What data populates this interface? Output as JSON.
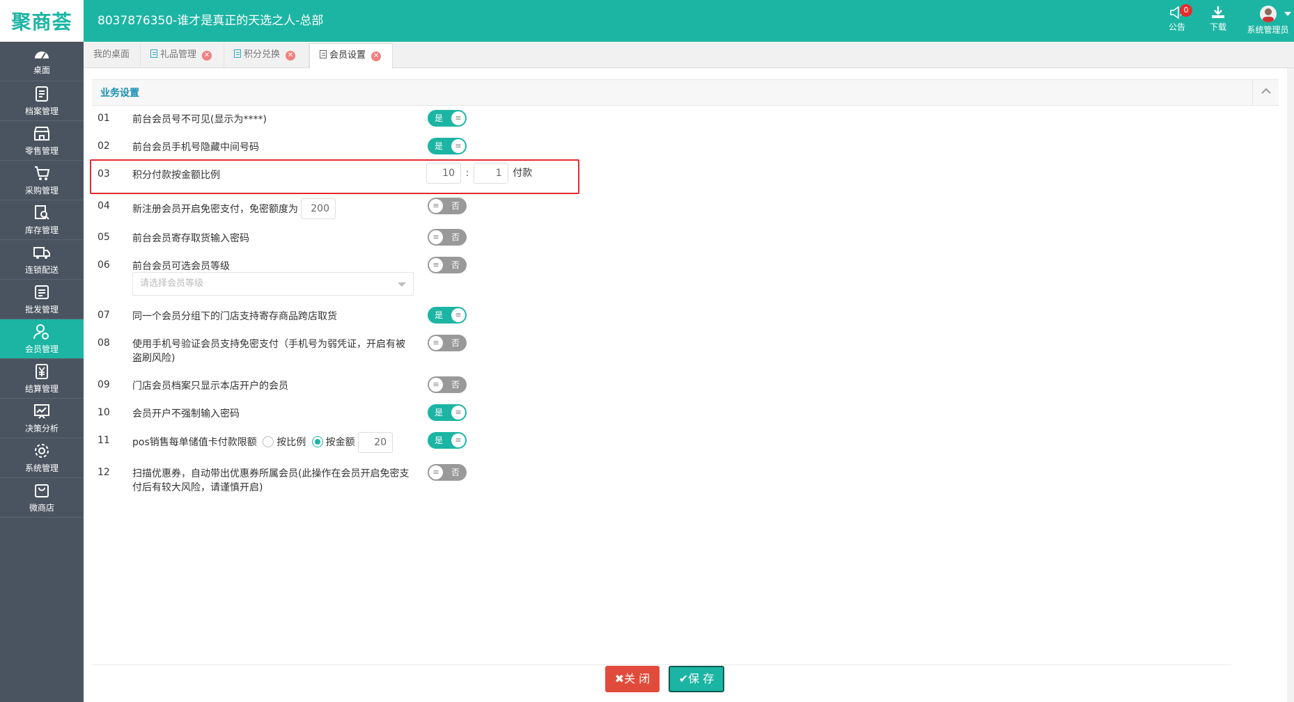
{
  "header": {
    "logo": "聚商荟",
    "title": "8037876350-谁才是真正的天选之人-总部",
    "notice_label": "公告",
    "notice_count": "0",
    "download_label": "下载",
    "user_label": "系统管理员"
  },
  "sidebar": {
    "items": [
      {
        "label": "桌面",
        "icon": "dashboard-icon"
      },
      {
        "label": "档案管理",
        "icon": "archive-icon"
      },
      {
        "label": "零售管理",
        "icon": "store-icon"
      },
      {
        "label": "采购管理",
        "icon": "cart-icon"
      },
      {
        "label": "库存管理",
        "icon": "inventory-icon"
      },
      {
        "label": "连锁配送",
        "icon": "truck-icon"
      },
      {
        "label": "批发管理",
        "icon": "wholesale-icon"
      },
      {
        "label": "会员管理",
        "icon": "member-icon",
        "active": true
      },
      {
        "label": "结算管理",
        "icon": "yen-icon"
      },
      {
        "label": "决策分析",
        "icon": "chart-icon"
      },
      {
        "label": "系统管理",
        "icon": "gear-icon"
      },
      {
        "label": "微商店",
        "icon": "shop-bag-icon"
      }
    ]
  },
  "tabs": [
    {
      "label": "我的桌面"
    },
    {
      "label": "礼品管理"
    },
    {
      "label": "积分兑换"
    },
    {
      "label": "会员设置",
      "active": true
    }
  ],
  "panel": {
    "title": "业务设置"
  },
  "settings": {
    "r01": {
      "num": "01",
      "label": "前台会员号不可见(显示为****)",
      "toggle": "是",
      "on": true
    },
    "r02": {
      "num": "02",
      "label": "前台会员手机号隐藏中间号码",
      "toggle": "是",
      "on": true
    },
    "r03": {
      "num": "03",
      "label": "积分付款按金额比例",
      "points": "10",
      "sep": ":",
      "amount": "1",
      "suffix": "付款"
    },
    "r04": {
      "num": "04",
      "label": "新注册会员开启免密支付，免密额度为",
      "limit": "200",
      "toggle": "否",
      "on": false
    },
    "r05": {
      "num": "05",
      "label": "前台会员寄存取货输入密码",
      "toggle": "否",
      "on": false
    },
    "r06": {
      "num": "06",
      "label": "前台会员可选会员等级",
      "toggle": "否",
      "on": false,
      "select_placeholder": "请选择会员等级"
    },
    "r07": {
      "num": "07",
      "label": "同一个会员分组下的门店支持寄存商品跨店取货",
      "toggle": "是",
      "on": true
    },
    "r08": {
      "num": "08",
      "label": "使用手机号验证会员支持免密支付（手机号为弱凭证，开启有被盗刷风险)",
      "toggle": "否",
      "on": false
    },
    "r09": {
      "num": "09",
      "label": "门店会员档案只显示本店开户的会员",
      "toggle": "否",
      "on": false
    },
    "r10": {
      "num": "10",
      "label": "会员开户不强制输入密码",
      "toggle": "是",
      "on": true
    },
    "r11": {
      "num": "11",
      "label": "pos销售每单储值卡付款限额",
      "opt1": "按比例",
      "opt2": "按金额",
      "opt_selected": "按金额",
      "limit": "20",
      "toggle": "是",
      "on": true
    },
    "r12": {
      "num": "12",
      "label": "扫描优惠券，自动带出优惠券所属会员(此操作在会员开启免密支付后有较大风险，请谨慎开启)",
      "toggle": "否",
      "on": false
    }
  },
  "footer": {
    "close_label": "关 闭",
    "save_label": "保 存"
  },
  "colors": {
    "brand": "#1cb5a3",
    "sidebar": "#4a5460",
    "danger": "#e14b3b",
    "highlight": "#e8282e"
  }
}
